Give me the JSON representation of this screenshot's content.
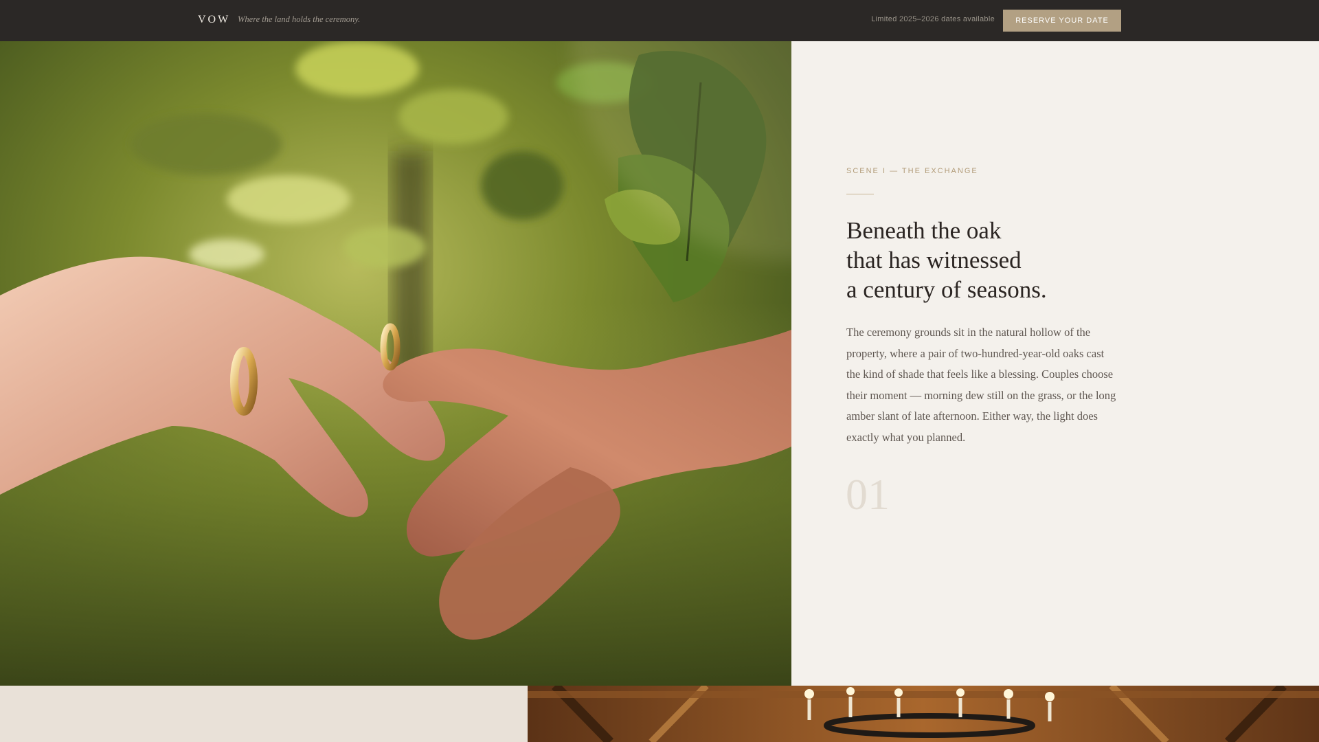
{
  "header": {
    "brand": "VOW",
    "tagline": "Where the land holds the ceremony.",
    "availability": "Limited 2025–2026 dates available",
    "cta_label": "RESERVE YOUR DATE"
  },
  "hero": {
    "image_icon": "hands-rings-photo"
  },
  "scene": {
    "eyebrow": "SCENE I — THE EXCHANGE",
    "headline_lines": [
      "Beneath the oak",
      "that has witnessed",
      "a century of seasons."
    ],
    "body": "The ceremony grounds sit in the natural hollow of the property, where a pair of two-hundred-year-old oaks cast the kind of shade that feels like a blessing. Couples choose their moment — morning dew still on the grass, or the long amber slant of late afternoon. Either way, the light does exactly what you planned.",
    "number": "01"
  },
  "next_section": {
    "image_icon": "barn-chandelier-photo"
  },
  "colors": {
    "topbar": "#2b2826",
    "accent": "#b2a083",
    "panel_bg": "#f4f1ec",
    "bottom_left_bg": "#e9e1d8"
  }
}
